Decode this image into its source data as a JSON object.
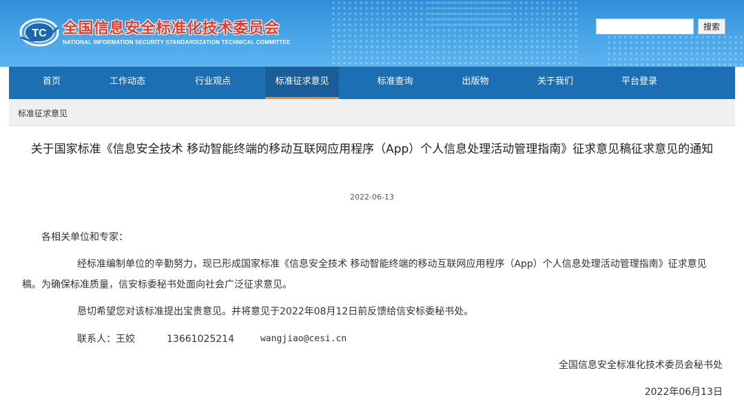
{
  "header": {
    "org_name_cn": "全国信息安全标准化技术委员会",
    "org_name_en": "NATIONAL INFORMATION SECURITY STANDARDIZATION TECHNICAL COMMITTEE",
    "logo_letters": "TC",
    "search_placeholder": "",
    "search_button": "搜索"
  },
  "nav": {
    "items": [
      {
        "label": "首页"
      },
      {
        "label": "工作动态"
      },
      {
        "label": "行业观点"
      },
      {
        "label": "标准征求意见"
      },
      {
        "label": "标准查询"
      },
      {
        "label": "出版物"
      },
      {
        "label": "关于我们"
      },
      {
        "label": "平台登录"
      }
    ],
    "active_index": 3
  },
  "breadcrumb": "标准征求意见",
  "article": {
    "title": "关于国家标准《信息安全技术 移动智能终端的移动互联网应用程序（App）个人信息处理活动管理指南》征求意见稿征求意见的通知",
    "date": "2022-06-13",
    "greeting": "各相关单位和专家：",
    "paragraph1": "经标准编制单位的辛勤努力，现已形成国家标准《信息安全技术 移动智能终端的移动互联网应用程序（App）个人信息处理活动管理指南》征求意见稿。为确保标准质量，信安标委秘书处面向社会广泛征求意见。",
    "paragraph2": "恳切希望您对该标准提出宝贵意见。并将意见于2022年08月12日前反馈给信安标委秘书处。",
    "contact_label": "联系人：王姣",
    "contact_phone": "13661025214",
    "contact_email": "wangjiao@cesi.cn",
    "signature": "全国信息安全标准化技术委员会秘书处",
    "signature_date": "2022年06月13日"
  },
  "colors": {
    "header_blue": "#3f9ee3",
    "nav_blue": "#1d6fb3",
    "nav_active_underline": "#f08a24",
    "logo_red": "#e83a2a"
  }
}
